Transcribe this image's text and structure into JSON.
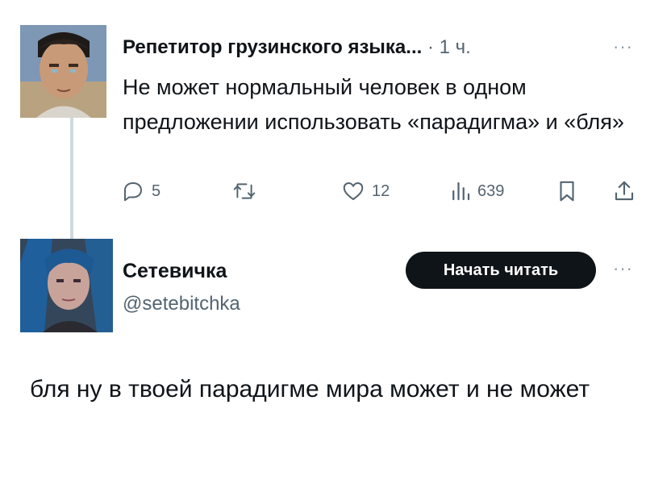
{
  "tweet1": {
    "author_name": "Репетитор грузинского языка...",
    "time": "· 1 ч.",
    "more": "···",
    "text": "Не может нормальный человек в одном предложении использовать «парадигма» и «бля»",
    "stats": {
      "replies": "5",
      "likes": "12",
      "views": "639"
    },
    "icons": [
      "reply-icon",
      "retweet-icon",
      "like-icon",
      "views-icon",
      "bookmark-icon",
      "share-icon"
    ]
  },
  "tweet2": {
    "author_name": "Сетевичка",
    "handle": "@setebitchka",
    "follow_label": "Начать читать",
    "more": "···",
    "text": "бля ну в твоей парадигме мира может и не может"
  },
  "colors": {
    "text": "#0f1419",
    "secondary": "#536471",
    "button_bg": "#0f1419",
    "thread_line": "#cfd9de"
  }
}
